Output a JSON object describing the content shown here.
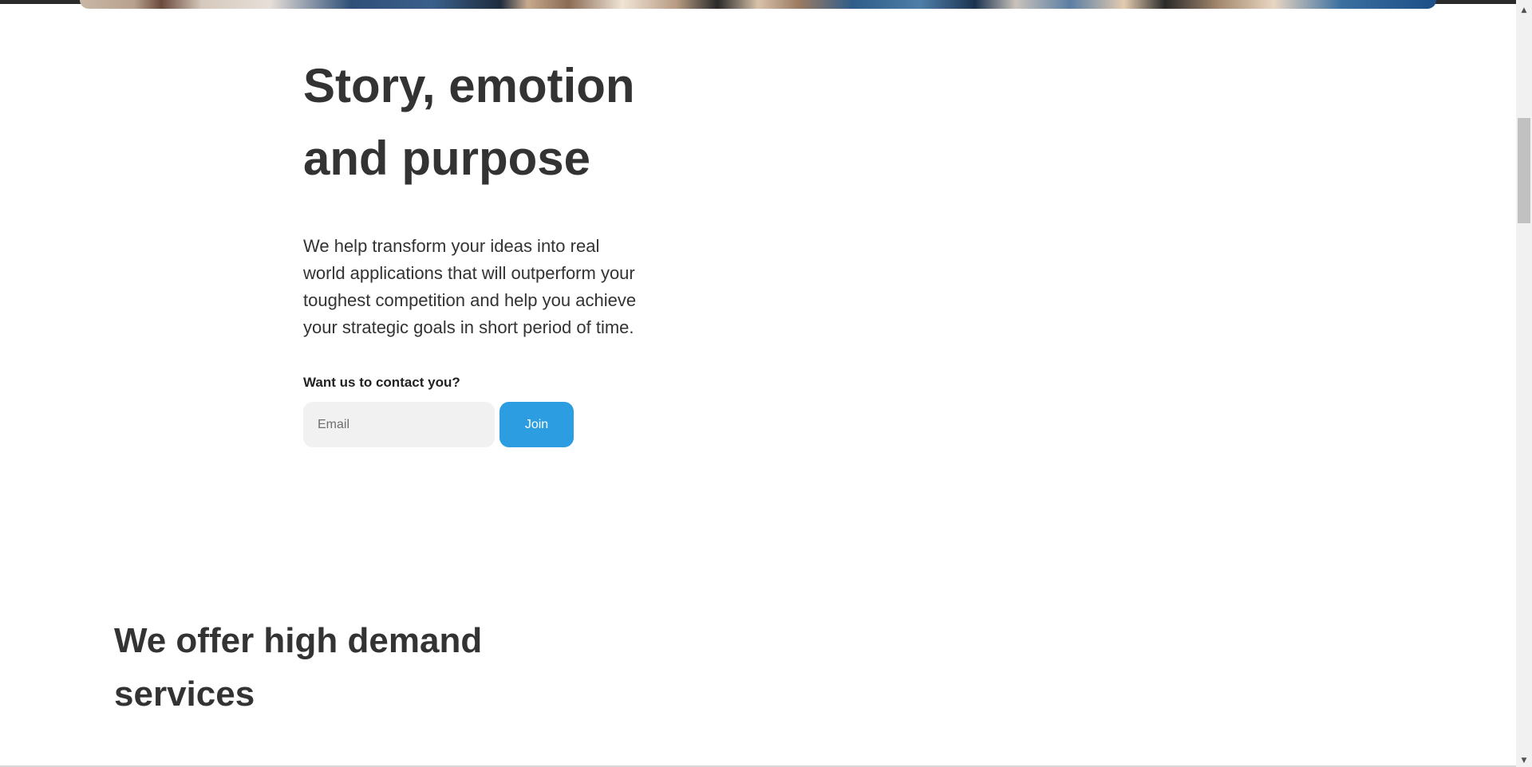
{
  "hero": {
    "title": "Story, emotion and purpose",
    "description": "We help transform your ideas into real world applications that will outperform your toughest competition and help you achieve your strategic goals in short period of time.",
    "contact_prompt": "Want us to contact you?",
    "email_placeholder": "Email",
    "join_label": "Join"
  },
  "services": {
    "title": "We offer high demand services"
  },
  "scrollbar": {
    "up_icon": "▲",
    "down_icon": "▼"
  },
  "colors": {
    "accent": "#2b9de0",
    "text": "#333333",
    "input_bg": "#f1f1f1"
  }
}
